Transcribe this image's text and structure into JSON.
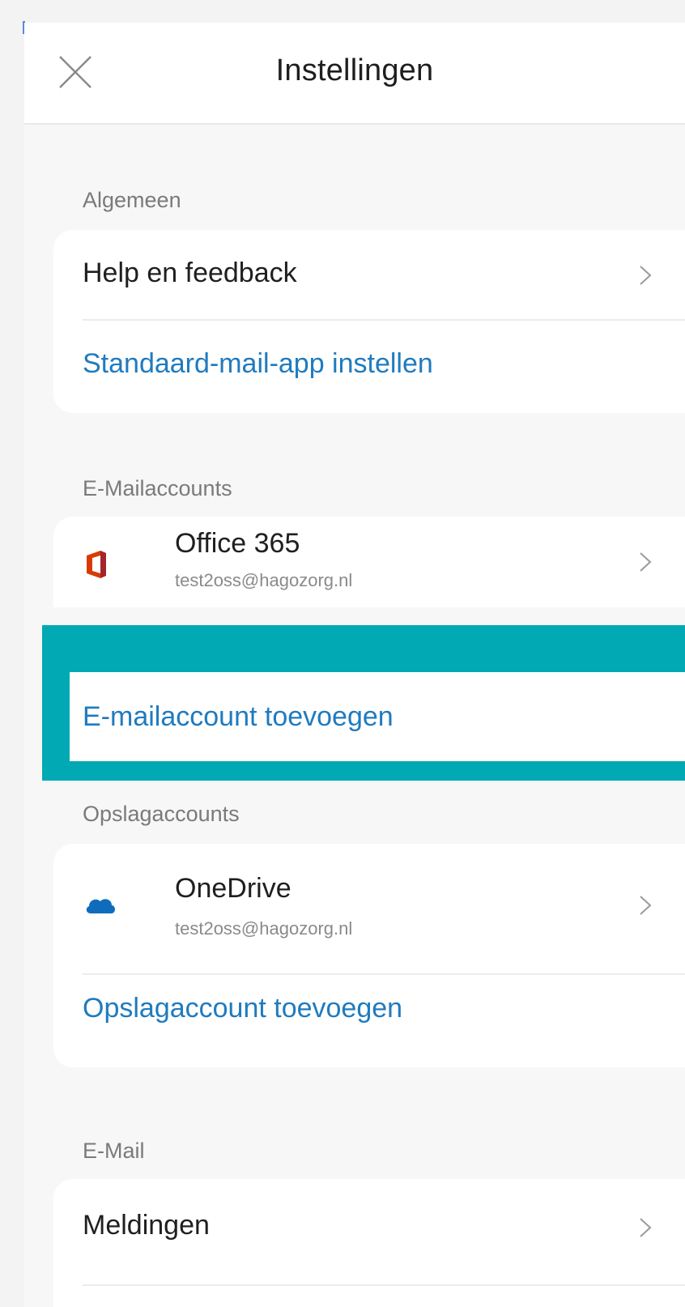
{
  "header": {
    "title": "Instellingen"
  },
  "sections": {
    "general": {
      "header": "Algemeen",
      "items": {
        "help": "Help en feedback",
        "default_mail": "Standaard-mail-app instellen"
      }
    },
    "mail_accounts": {
      "header": "E-Mailaccounts",
      "account": {
        "name": "Office 365",
        "email": "test2oss@hagozorg.nl"
      },
      "add": "E-mailaccount toevoegen"
    },
    "storage_accounts": {
      "header": "Opslagaccounts",
      "account": {
        "name": "OneDrive",
        "email": "test2oss@hagozorg.nl"
      },
      "add": "Opslagaccount toevoegen"
    },
    "email": {
      "header": "E-Mail",
      "items": {
        "notifications": "Meldingen"
      }
    }
  },
  "colors": {
    "link": "#1f7bbf",
    "highlight": "#00a9b3",
    "office_icon": "#d83b01",
    "onedrive_icon": "#0f6cbd"
  },
  "icons": [
    "close-icon",
    "chevron-right-icon",
    "office-365-icon",
    "onedrive-icon"
  ]
}
